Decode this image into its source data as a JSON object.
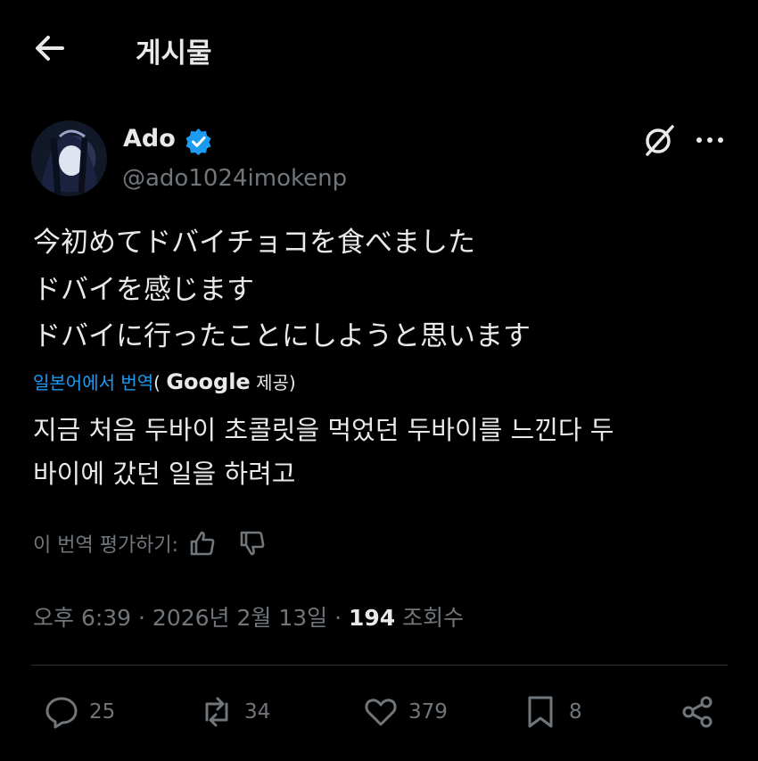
{
  "header": {
    "title": "게시물",
    "back_icon": "arrow-left-icon"
  },
  "author": {
    "name": "Ado",
    "handle": "@ado1024imokenp",
    "verified_color": "#1d9bf0",
    "avatar_icon": "avatar"
  },
  "tweet": {
    "lines": [
      "今初めてドバイチョコを食べました",
      "ドバイを感じます",
      "ドバイに行ったことにしようと思います"
    ]
  },
  "translation": {
    "link_label": "일본어에서 번역",
    "provider_prefix": "(",
    "provider": "Google",
    "provider_suffix": "제공)",
    "lines": [
      "지금 처음 두바이 초콜릿을 먹었던 두바이를 느낀다 두",
      "바이에 갔던 일을 하려고"
    ],
    "rate_label": "이 번역 평가하기:"
  },
  "meta": {
    "time_date": "오후 6:39 · 2026년 2월 13일 · ",
    "views_count": "194",
    "views_label": " 조회수"
  },
  "actions": {
    "replies": "25",
    "reposts": "34",
    "likes": "379",
    "bookmarks": "8"
  },
  "colors": {
    "background": "#000000",
    "text": "#e7e9ea",
    "muted": "#71767b",
    "accent": "#1d9bf0"
  }
}
